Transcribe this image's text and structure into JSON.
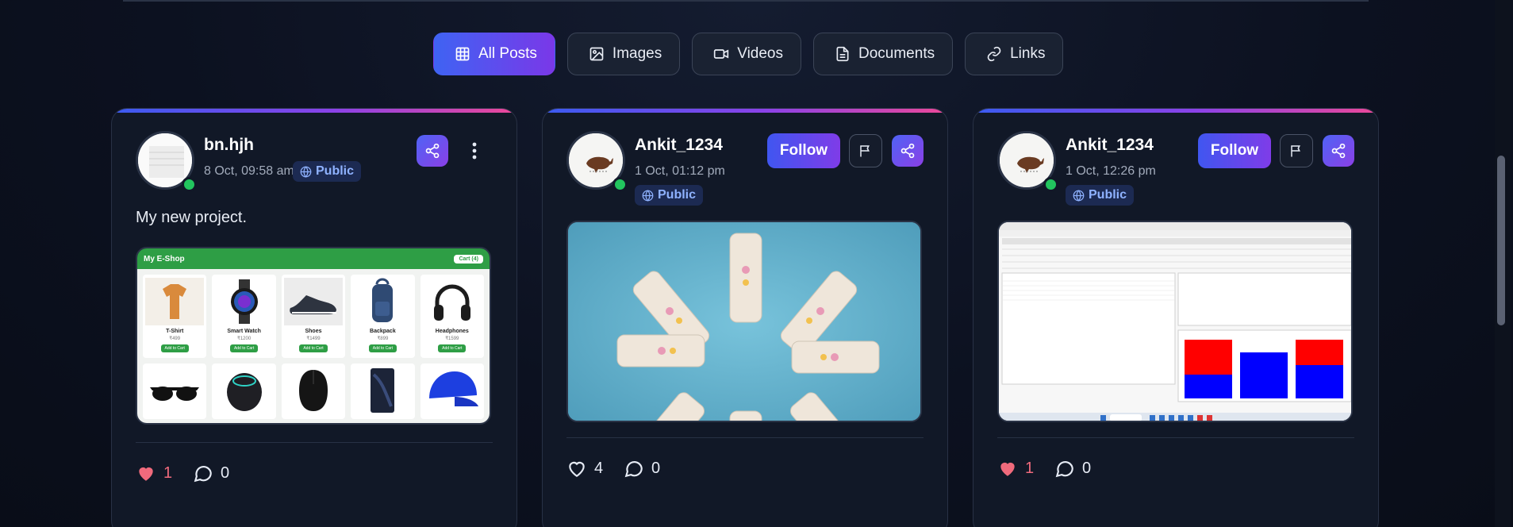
{
  "filters": {
    "tabs": [
      {
        "label": "All Posts",
        "icon": "grid-icon",
        "active": true
      },
      {
        "label": "Images",
        "icon": "image-icon",
        "active": false
      },
      {
        "label": "Videos",
        "icon": "video-icon",
        "active": false
      },
      {
        "label": "Documents",
        "icon": "document-icon",
        "active": false
      },
      {
        "label": "Links",
        "icon": "link-icon",
        "active": false
      }
    ]
  },
  "posts": [
    {
      "author": "bn.hjh",
      "date": "8 Oct, 09:58 am",
      "visibility": "Public",
      "caption": "My new project.",
      "likes": "1",
      "liked": true,
      "comments": "0",
      "shop": {
        "title": "My E-Shop",
        "cart": "Cart (4)",
        "products": [
          {
            "name": "T-Shirt",
            "price": "₹499",
            "button": "Add to Cart"
          },
          {
            "name": "Smart Watch",
            "price": "₹1200",
            "button": "Add to Cart"
          },
          {
            "name": "Shoes",
            "price": "₹1499",
            "button": "Add to Cart"
          },
          {
            "name": "Backpack",
            "price": "₹899",
            "button": "Add to Cart"
          },
          {
            "name": "Headphones",
            "price": "₹1599",
            "button": "Add to Cart"
          }
        ]
      }
    },
    {
      "author": "Ankit_1234",
      "date": "1 Oct, 01:12 pm",
      "visibility": "Public",
      "follow_label": "Follow",
      "likes": "4",
      "liked": false,
      "comments": "0"
    },
    {
      "author": "Ankit_1234",
      "date": "1 Oct, 12:26 pm",
      "visibility": "Public",
      "follow_label": "Follow",
      "likes": "1",
      "liked": true,
      "comments": "0"
    }
  ],
  "colors": {
    "accent_start": "#3f63f3",
    "accent_end": "#7a38e8",
    "like": "#f06a7c",
    "online": "#22c55e"
  }
}
